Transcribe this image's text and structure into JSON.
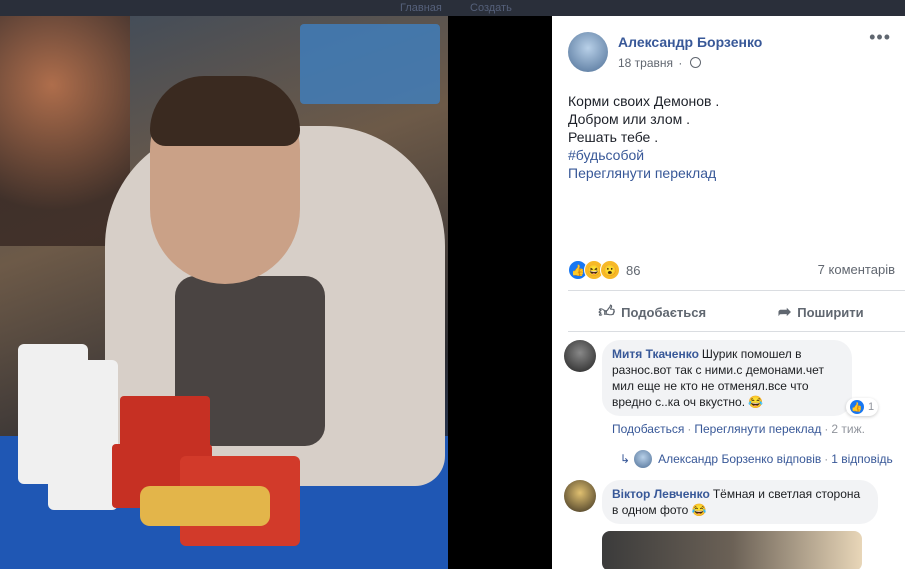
{
  "top_bar": {
    "item1": "Главная",
    "item2": "Создать"
  },
  "post": {
    "author": "Александр Борзенко",
    "date": "18 травня",
    "more": "•••",
    "lines": [
      "Корми своих Демонов .",
      "Добром или злом .",
      "Решать тебе ."
    ],
    "hashtag": "#будьсобой",
    "translate": "Переглянути переклад",
    "reaction_count": "86",
    "comments_count": "7 коментарів",
    "actions": {
      "like": "Подобається",
      "share": "Поширити"
    }
  },
  "comments": [
    {
      "author": "Митя Ткаченко",
      "text": "Шурик помошел в разнос.вот так с ними.с демонами.чет мил еще не кто не отменял.все что вредно с..ка оч вкустно.",
      "emoji": "😂",
      "likes": "1",
      "links": {
        "like": "Подобається",
        "translate": "Переглянути переклад",
        "ago": "2 тиж."
      },
      "reply": {
        "author": "Александр Борзенко",
        "verb": "відповів",
        "count": "1 відповідь"
      }
    },
    {
      "author": "Віктор Левченко",
      "text": "Тёмная и светлая сторона в одном фото",
      "emoji": "😂"
    }
  ],
  "colors": {
    "link": "#385898",
    "text": "#1d2129",
    "muted": "#616770",
    "like_blue": "#1877f2",
    "table_blue": "#1f57b4"
  },
  "icons": [
    "more-icon",
    "globe-icon",
    "like-reaction-icon",
    "haha-reaction-icon",
    "wow-reaction-icon",
    "thumb-up-icon",
    "share-icon",
    "reply-arrow-icon"
  ]
}
